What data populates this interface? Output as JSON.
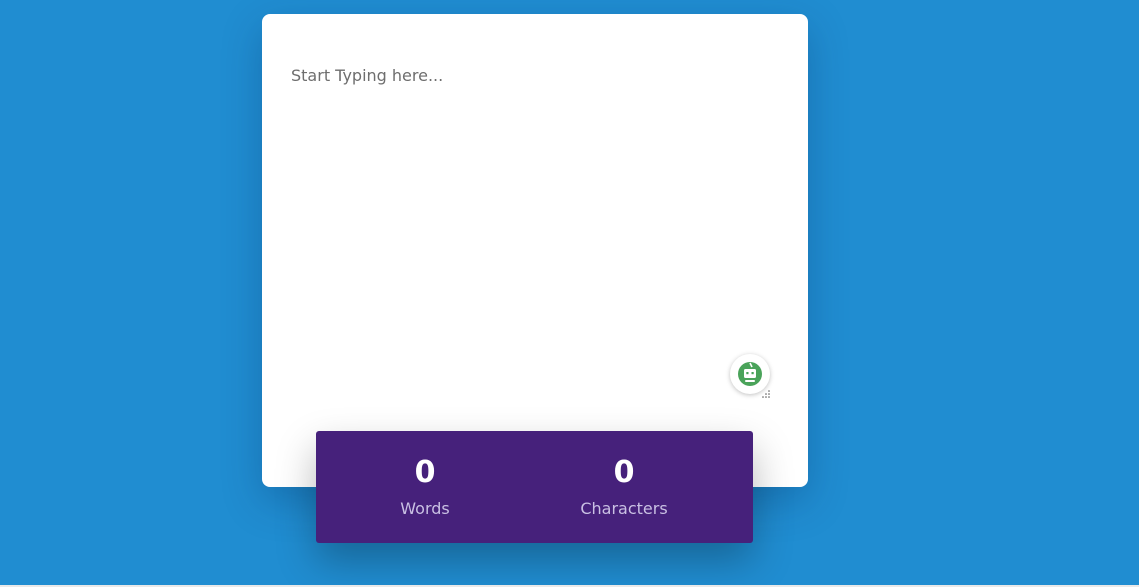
{
  "editor": {
    "placeholder": "Start Typing here...",
    "value": ""
  },
  "stats": {
    "words": {
      "value": "0",
      "label": "Words"
    },
    "characters": {
      "value": "0",
      "label": "Characters"
    }
  },
  "colors": {
    "background": "#208dd1",
    "card": "#ffffff",
    "stats_panel": "#46217b",
    "stat_value": "#ffffff",
    "stat_label": "#c9c0e3",
    "widget_icon": "#4aa35a"
  },
  "icons": {
    "grammar_widget": "robot-icon",
    "resize_handle": "resize-grip-icon"
  }
}
